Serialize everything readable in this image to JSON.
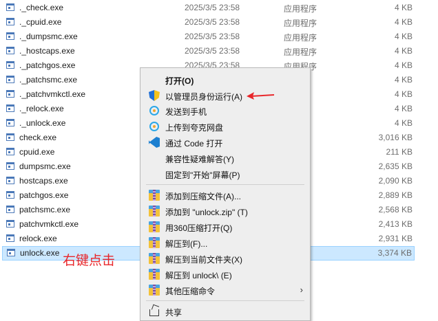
{
  "files": [
    {
      "name": "._check.exe",
      "date": "2025/3/5 23:58",
      "type": "应用程序",
      "size": "4 KB"
    },
    {
      "name": "._cpuid.exe",
      "date": "2025/3/5 23:58",
      "type": "应用程序",
      "size": "4 KB"
    },
    {
      "name": "._dumpsmc.exe",
      "date": "2025/3/5 23:58",
      "type": "应用程序",
      "size": "4 KB"
    },
    {
      "name": "._hostcaps.exe",
      "date": "2025/3/5 23:58",
      "type": "应用程序",
      "size": "4 KB"
    },
    {
      "name": "._patchgos.exe",
      "date": "2025/3/5 23:58",
      "type": "应用程序",
      "size": "4 KB"
    },
    {
      "name": "._patchsmc.exe",
      "date": "",
      "type": "",
      "size": "4 KB"
    },
    {
      "name": "._patchvmkctl.exe",
      "date": "",
      "type": "",
      "size": "4 KB"
    },
    {
      "name": "._relock.exe",
      "date": "",
      "type": "",
      "size": "4 KB"
    },
    {
      "name": "._unlock.exe",
      "date": "",
      "type": "",
      "size": "4 KB"
    },
    {
      "name": "check.exe",
      "date": "",
      "type": "",
      "size": "3,016 KB"
    },
    {
      "name": "cpuid.exe",
      "date": "",
      "type": "",
      "size": "211 KB"
    },
    {
      "name": "dumpsmc.exe",
      "date": "",
      "type": "",
      "size": "2,635 KB"
    },
    {
      "name": "hostcaps.exe",
      "date": "",
      "type": "",
      "size": "2,090 KB"
    },
    {
      "name": "patchgos.exe",
      "date": "",
      "type": "",
      "size": "2,889 KB"
    },
    {
      "name": "patchsmc.exe",
      "date": "",
      "type": "",
      "size": "2,568 KB"
    },
    {
      "name": "patchvmkctl.exe",
      "date": "",
      "type": "",
      "size": "2,413 KB"
    },
    {
      "name": "relock.exe",
      "date": "",
      "type": "",
      "size": "2,931 KB"
    },
    {
      "name": "unlock.exe",
      "date": "",
      "type": "序",
      "size": "3,374 KB",
      "selected": true
    }
  ],
  "annotation": "右键点击",
  "menu": {
    "open": "打开(O)",
    "run_as_admin": "以管理员身份运行(A)",
    "send_to_phone": "发送到手机",
    "upload_cloud": "上传到夸克网盘",
    "open_with_code": "通过 Code 打开",
    "compat": "兼容性疑难解答(Y)",
    "pin_start": "固定到\"开始\"屏幕(P)",
    "add_archive": "添加到压缩文件(A)...",
    "add_zip": "添加到 \"unlock.zip\" (T)",
    "open_360": "用360压缩打开(Q)",
    "extract_to": "解压到(F)...",
    "extract_here": "解压到当前文件夹(X)",
    "extract_folder": "解压到 unlock\\ (E)",
    "other_cmds": "其他压缩命令",
    "share": "共享"
  },
  "colors": {
    "annotation": "#e8262a",
    "selection": "#cce8ff"
  }
}
